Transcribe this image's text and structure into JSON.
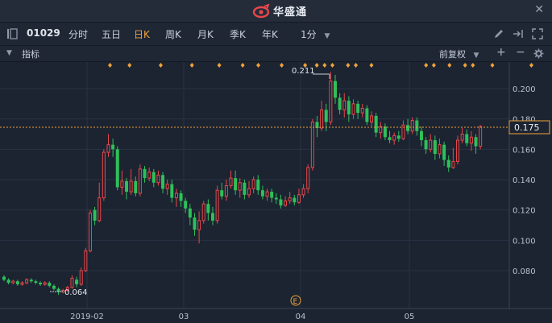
{
  "app": {
    "title": "华盛通"
  },
  "toolbar": {
    "code": "01029",
    "tabs": [
      "分时",
      "五日",
      "日K",
      "周K",
      "月K",
      "季K",
      "年K"
    ],
    "active_tab": "日K",
    "interval": "1分"
  },
  "subbar": {
    "indicator_label": "指标",
    "adjust_label": "前复权",
    "plus": "+",
    "minus": "−"
  },
  "colors": {
    "up": "#e8474a",
    "down": "#2ec05a",
    "accent": "#f0a23a",
    "bg": "#1c2431",
    "grid": "#283244"
  },
  "icons": [
    "logo-icon",
    "close-icon",
    "sidebar-toggle-icon",
    "dropdown-icon",
    "pen-icon",
    "share-icon",
    "fullscreen-icon",
    "collapse-icon",
    "settings-icon"
  ],
  "chart_data": {
    "type": "candlestick",
    "y_ticks": [
      "0.200",
      "0.180",
      "0.160",
      "0.140",
      "0.120",
      "0.100",
      "0.080"
    ],
    "x_ticks": [
      "2019-02",
      "03",
      "04",
      "05"
    ],
    "ylim": [
      0.06,
      0.215
    ],
    "current_price": "0.175",
    "high_label": "0.211",
    "low_label": "0.064",
    "event_marker": "E",
    "candles": [
      [
        0.076,
        0.074,
        0.077,
        0.073
      ],
      [
        0.074,
        0.072,
        0.075,
        0.071
      ],
      [
        0.072,
        0.073,
        0.074,
        0.071
      ],
      [
        0.073,
        0.071,
        0.074,
        0.07
      ],
      [
        0.071,
        0.072,
        0.073,
        0.07
      ],
      [
        0.072,
        0.074,
        0.075,
        0.071
      ],
      [
        0.074,
        0.073,
        0.075,
        0.072
      ],
      [
        0.073,
        0.072,
        0.074,
        0.071
      ],
      [
        0.072,
        0.071,
        0.073,
        0.07
      ],
      [
        0.071,
        0.072,
        0.073,
        0.07
      ],
      [
        0.072,
        0.07,
        0.073,
        0.069
      ],
      [
        0.07,
        0.068,
        0.071,
        0.067
      ],
      [
        0.068,
        0.066,
        0.069,
        0.064
      ],
      [
        0.066,
        0.067,
        0.068,
        0.065
      ],
      [
        0.067,
        0.069,
        0.07,
        0.066
      ],
      [
        0.069,
        0.075,
        0.077,
        0.068
      ],
      [
        0.074,
        0.071,
        0.076,
        0.069
      ],
      [
        0.071,
        0.08,
        0.082,
        0.07
      ],
      [
        0.08,
        0.093,
        0.095,
        0.079
      ],
      [
        0.093,
        0.118,
        0.12,
        0.092
      ],
      [
        0.12,
        0.113,
        0.122,
        0.11
      ],
      [
        0.113,
        0.128,
        0.138,
        0.112
      ],
      [
        0.128,
        0.158,
        0.16,
        0.126
      ],
      [
        0.158,
        0.163,
        0.17,
        0.155
      ],
      [
        0.163,
        0.16,
        0.167,
        0.155
      ],
      [
        0.16,
        0.135,
        0.162,
        0.133
      ],
      [
        0.135,
        0.139,
        0.146,
        0.13
      ],
      [
        0.139,
        0.132,
        0.141,
        0.127
      ],
      [
        0.132,
        0.139,
        0.147,
        0.13
      ],
      [
        0.139,
        0.131,
        0.142,
        0.129
      ],
      [
        0.131,
        0.147,
        0.15,
        0.129
      ],
      [
        0.147,
        0.141,
        0.149,
        0.138
      ],
      [
        0.141,
        0.145,
        0.148,
        0.139
      ],
      [
        0.145,
        0.138,
        0.147,
        0.135
      ],
      [
        0.138,
        0.143,
        0.146,
        0.136
      ],
      [
        0.143,
        0.134,
        0.145,
        0.131
      ],
      [
        0.134,
        0.137,
        0.14,
        0.13
      ],
      [
        0.137,
        0.128,
        0.14,
        0.125
      ],
      [
        0.128,
        0.131,
        0.134,
        0.122
      ],
      [
        0.131,
        0.126,
        0.133,
        0.122
      ],
      [
        0.126,
        0.121,
        0.128,
        0.118
      ],
      [
        0.121,
        0.115,
        0.124,
        0.11
      ],
      [
        0.115,
        0.107,
        0.118,
        0.103
      ],
      [
        0.107,
        0.113,
        0.119,
        0.098
      ],
      [
        0.113,
        0.124,
        0.126,
        0.111
      ],
      [
        0.124,
        0.118,
        0.127,
        0.113
      ],
      [
        0.118,
        0.113,
        0.122,
        0.11
      ],
      [
        0.113,
        0.133,
        0.136,
        0.111
      ],
      [
        0.133,
        0.129,
        0.138,
        0.127
      ],
      [
        0.129,
        0.136,
        0.14,
        0.126
      ],
      [
        0.136,
        0.141,
        0.146,
        0.134
      ],
      [
        0.141,
        0.133,
        0.146,
        0.13
      ],
      [
        0.133,
        0.138,
        0.141,
        0.128
      ],
      [
        0.138,
        0.13,
        0.14,
        0.127
      ],
      [
        0.13,
        0.134,
        0.139,
        0.128
      ],
      [
        0.134,
        0.14,
        0.142,
        0.131
      ],
      [
        0.14,
        0.133,
        0.143,
        0.13
      ],
      [
        0.133,
        0.129,
        0.136,
        0.127
      ],
      [
        0.129,
        0.132,
        0.134,
        0.126
      ],
      [
        0.132,
        0.128,
        0.134,
        0.125
      ],
      [
        0.128,
        0.127,
        0.131,
        0.124
      ],
      [
        0.127,
        0.123,
        0.13,
        0.121
      ],
      [
        0.123,
        0.126,
        0.129,
        0.122
      ],
      [
        0.126,
        0.128,
        0.132,
        0.124
      ],
      [
        0.128,
        0.125,
        0.13,
        0.123
      ],
      [
        0.125,
        0.13,
        0.134,
        0.124
      ],
      [
        0.13,
        0.134,
        0.137,
        0.128
      ],
      [
        0.134,
        0.148,
        0.15,
        0.131
      ],
      [
        0.148,
        0.178,
        0.18,
        0.146
      ],
      [
        0.178,
        0.174,
        0.182,
        0.168
      ],
      [
        0.174,
        0.186,
        0.192,
        0.172
      ],
      [
        0.186,
        0.178,
        0.19,
        0.172
      ],
      [
        0.178,
        0.205,
        0.211,
        0.176
      ],
      [
        0.205,
        0.194,
        0.209,
        0.19
      ],
      [
        0.194,
        0.186,
        0.197,
        0.183
      ],
      [
        0.186,
        0.192,
        0.197,
        0.181
      ],
      [
        0.192,
        0.183,
        0.195,
        0.178
      ],
      [
        0.183,
        0.19,
        0.193,
        0.18
      ],
      [
        0.19,
        0.184,
        0.192,
        0.18
      ],
      [
        0.184,
        0.187,
        0.19,
        0.181
      ],
      [
        0.187,
        0.178,
        0.189,
        0.176
      ],
      [
        0.178,
        0.182,
        0.185,
        0.175
      ],
      [
        0.182,
        0.171,
        0.184,
        0.168
      ],
      [
        0.171,
        0.175,
        0.178,
        0.167
      ],
      [
        0.175,
        0.168,
        0.177,
        0.166
      ],
      [
        0.168,
        0.166,
        0.172,
        0.164
      ],
      [
        0.166,
        0.169,
        0.171,
        0.163
      ],
      [
        0.169,
        0.167,
        0.172,
        0.165
      ],
      [
        0.167,
        0.176,
        0.179,
        0.166
      ],
      [
        0.176,
        0.172,
        0.18,
        0.17
      ],
      [
        0.172,
        0.179,
        0.181,
        0.17
      ],
      [
        0.179,
        0.172,
        0.181,
        0.169
      ],
      [
        0.172,
        0.166,
        0.175,
        0.162
      ],
      [
        0.166,
        0.16,
        0.168,
        0.157
      ],
      [
        0.16,
        0.166,
        0.17,
        0.158
      ],
      [
        0.166,
        0.157,
        0.169,
        0.153
      ],
      [
        0.157,
        0.163,
        0.167,
        0.154
      ],
      [
        0.163,
        0.153,
        0.165,
        0.149
      ],
      [
        0.153,
        0.148,
        0.156,
        0.145
      ],
      [
        0.148,
        0.152,
        0.161,
        0.147
      ],
      [
        0.152,
        0.166,
        0.169,
        0.15
      ],
      [
        0.166,
        0.17,
        0.174,
        0.164
      ],
      [
        0.17,
        0.164,
        0.173,
        0.162
      ],
      [
        0.164,
        0.168,
        0.172,
        0.159
      ],
      [
        0.168,
        0.162,
        0.17,
        0.157
      ],
      [
        0.162,
        0.175,
        0.176,
        0.16
      ]
    ],
    "event_dots": [
      13,
      18,
      26,
      34,
      41,
      47,
      51,
      57,
      63,
      66,
      68,
      70,
      74,
      76,
      80,
      94,
      96,
      100,
      104,
      106,
      111,
      121,
      133
    ]
  }
}
